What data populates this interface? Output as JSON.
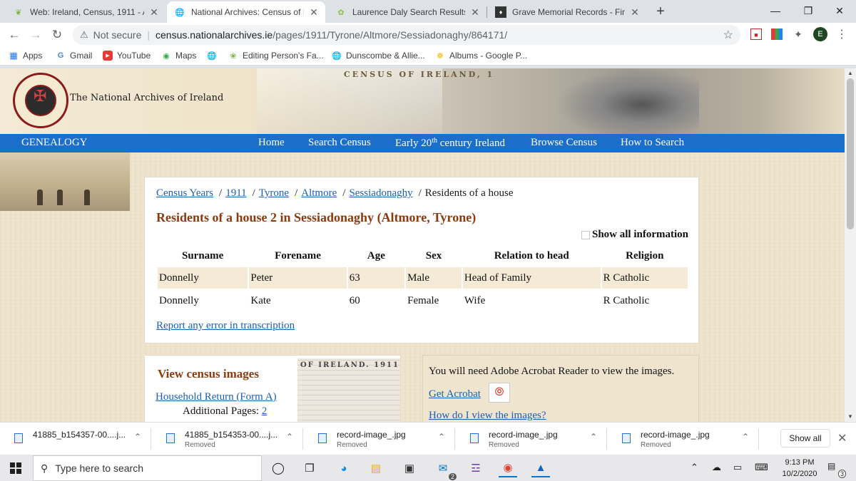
{
  "browser": {
    "tabs": [
      {
        "title": "Web: Ireland, Census, 1911 - Anc",
        "icon": "ancestry-leaf-icon",
        "active": false
      },
      {
        "title": "National Archives: Census of Irela",
        "icon": "globe-icon",
        "active": true
      },
      {
        "title": "Laurence Daly Search Results",
        "icon": "leaf-icon",
        "active": false
      },
      {
        "title": "Grave Memorial Records - Find A",
        "icon": "findagrave-icon",
        "active": false
      }
    ],
    "new_tab": "+",
    "address": {
      "security": "Not secure",
      "host": "census.nationalarchives.ie",
      "path": "/pages/1911/Tyrone/Altmore/Sessiadonaghy/864171/"
    },
    "profile_initial": "E",
    "bookmarks": [
      {
        "label": "Apps",
        "icon": "apps-grid-icon"
      },
      {
        "label": "Gmail",
        "icon": "google-g-icon"
      },
      {
        "label": "YouTube",
        "icon": "youtube-icon"
      },
      {
        "label": "Maps",
        "icon": "maps-pin-icon"
      },
      {
        "label": "",
        "icon": "globe-icon"
      },
      {
        "label": "Editing Person's Fa...",
        "icon": "familysearch-icon"
      },
      {
        "label": "Dunscombe & Allie...",
        "icon": "globe-icon"
      },
      {
        "label": "Albums - Google P...",
        "icon": "google-photos-icon"
      }
    ]
  },
  "site": {
    "org_name": "The National Archives of Ireland",
    "banner_text": "CENSUS OF IRELAND, 1",
    "nav": {
      "genealogy": "GENEALOGY",
      "home": "Home",
      "search": "Search Census",
      "early_pre": "Early 20",
      "early_sup": "th",
      "early_post": " century Ireland",
      "browse": "Browse Census",
      "how": "How to Search"
    }
  },
  "breadcrumb": {
    "items": [
      "Census Years",
      "1911",
      "Tyrone",
      "Altmore",
      "Sessiadonaghy"
    ],
    "current": "Residents of a house",
    "separator": "/"
  },
  "results": {
    "title": "Residents of a house 2 in Sessiadonaghy (Altmore, Tyrone)",
    "show_all_label": "Show all information",
    "show_all_checked": false,
    "columns": [
      "Surname",
      "Forename",
      "Age",
      "Sex",
      "Relation to head",
      "Religion"
    ],
    "rows": [
      [
        "Donnelly",
        "Peter",
        "63",
        "Male",
        "Head of Family",
        "R Catholic"
      ],
      [
        "Donnelly",
        "Kate",
        "60",
        "Female",
        "Wife",
        "R Catholic"
      ]
    ],
    "report_link": "Report any error in transcription"
  },
  "images_box": {
    "title": "View census images",
    "household_link": "Household Return (Form A)",
    "additional_label": "Additional Pages:",
    "additional_count": "2",
    "thumb_text": "OF IRELAND. 1911."
  },
  "acrobat_box": {
    "need_text": "You will need Adobe Acrobat Reader to view the images.",
    "get_acrobat": "Get Acrobat",
    "how_view": "How do I view the images?"
  },
  "downloads": {
    "items": [
      {
        "name": "41885_b154357-00....j...",
        "status": ""
      },
      {
        "name": "41885_b154353-00....j...",
        "status": "Removed"
      },
      {
        "name": "record-image_.jpg",
        "status": "Removed"
      },
      {
        "name": "record-image_.jpg",
        "status": "Removed"
      },
      {
        "name": "record-image_.jpg",
        "status": "Removed"
      }
    ],
    "show_all": "Show all"
  },
  "taskbar": {
    "search_placeholder": "Type here to search",
    "mail_badge": "2",
    "time": "9:13 PM",
    "date": "10/2/2020",
    "notification_count": "3"
  },
  "colors": {
    "nav_blue": "#1c6ecb",
    "title_brown": "#8b3a0e",
    "link_blue": "#1a5fb4",
    "row_shade": "#f4ead6"
  }
}
